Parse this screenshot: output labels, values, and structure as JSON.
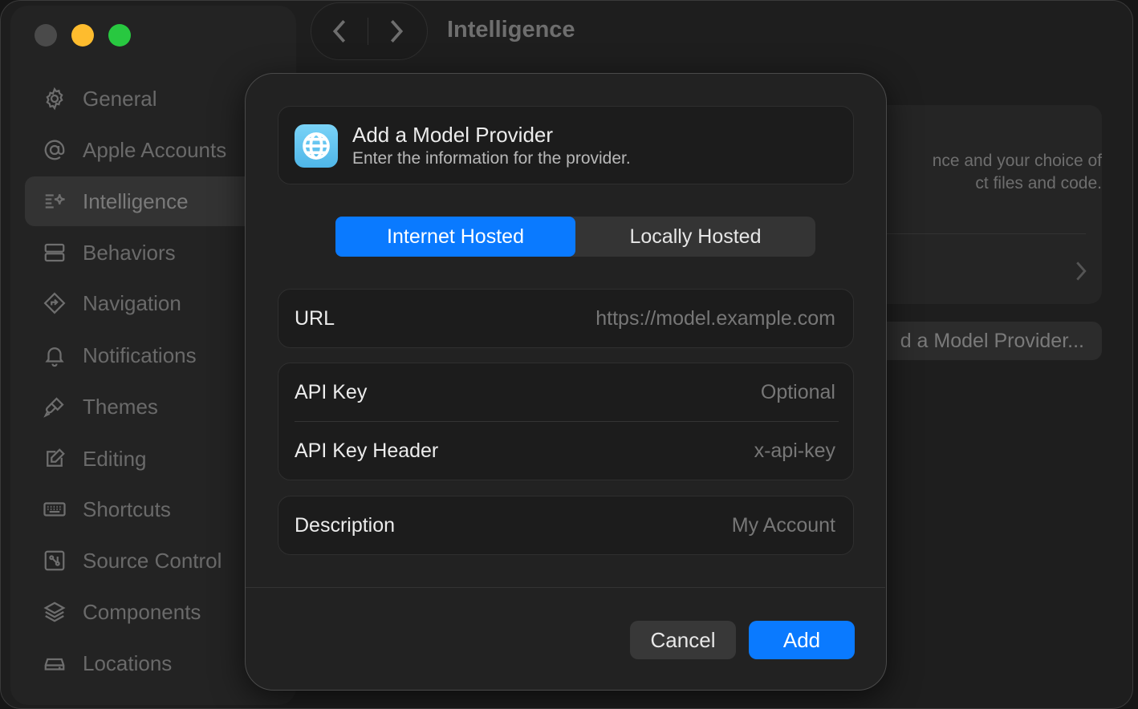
{
  "window": {
    "title": "Intelligence"
  },
  "sidebar": {
    "items": [
      {
        "label": "General",
        "icon": "gear-icon"
      },
      {
        "label": "Apple Accounts",
        "icon": "at-sign-icon"
      },
      {
        "label": "Intelligence",
        "icon": "sparkle-icon",
        "selected": true
      },
      {
        "label": "Behaviors",
        "icon": "stacked-rect-icon"
      },
      {
        "label": "Navigation",
        "icon": "direction-sign-icon"
      },
      {
        "label": "Notifications",
        "icon": "bell-icon"
      },
      {
        "label": "Themes",
        "icon": "paintbrush-icon"
      },
      {
        "label": "Editing",
        "icon": "edit-square-icon"
      },
      {
        "label": "Shortcuts",
        "icon": "keyboard-icon"
      },
      {
        "label": "Source Control",
        "icon": "source-control-icon"
      },
      {
        "label": "Components",
        "icon": "layers-icon"
      },
      {
        "label": "Locations",
        "icon": "drive-icon"
      }
    ]
  },
  "background": {
    "description_fragment_1": "nce and your choice of",
    "description_fragment_2": "ct files and code.",
    "add_provider_button": "d a Model Provider..."
  },
  "dialog": {
    "title": "Add a Model Provider",
    "subtitle": "Enter the information for the provider.",
    "icon": "globe-icon",
    "segments": [
      "Internet Hosted",
      "Locally Hosted"
    ],
    "selected_segment": "Internet Hosted",
    "fields": {
      "url": {
        "label": "URL",
        "value": "",
        "placeholder": "https://model.example.com"
      },
      "api_key": {
        "label": "API Key",
        "value": "",
        "placeholder": "Optional"
      },
      "api_key_header": {
        "label": "API Key Header",
        "value": "",
        "placeholder": "x-api-key"
      },
      "description": {
        "label": "Description",
        "value": "",
        "placeholder": "My Account"
      }
    },
    "cancel_label": "Cancel",
    "add_label": "Add"
  },
  "colors": {
    "accent": "#0a7aff",
    "close": "#4a4a4a",
    "minimize": "#febc2e",
    "maximize": "#28c840"
  }
}
